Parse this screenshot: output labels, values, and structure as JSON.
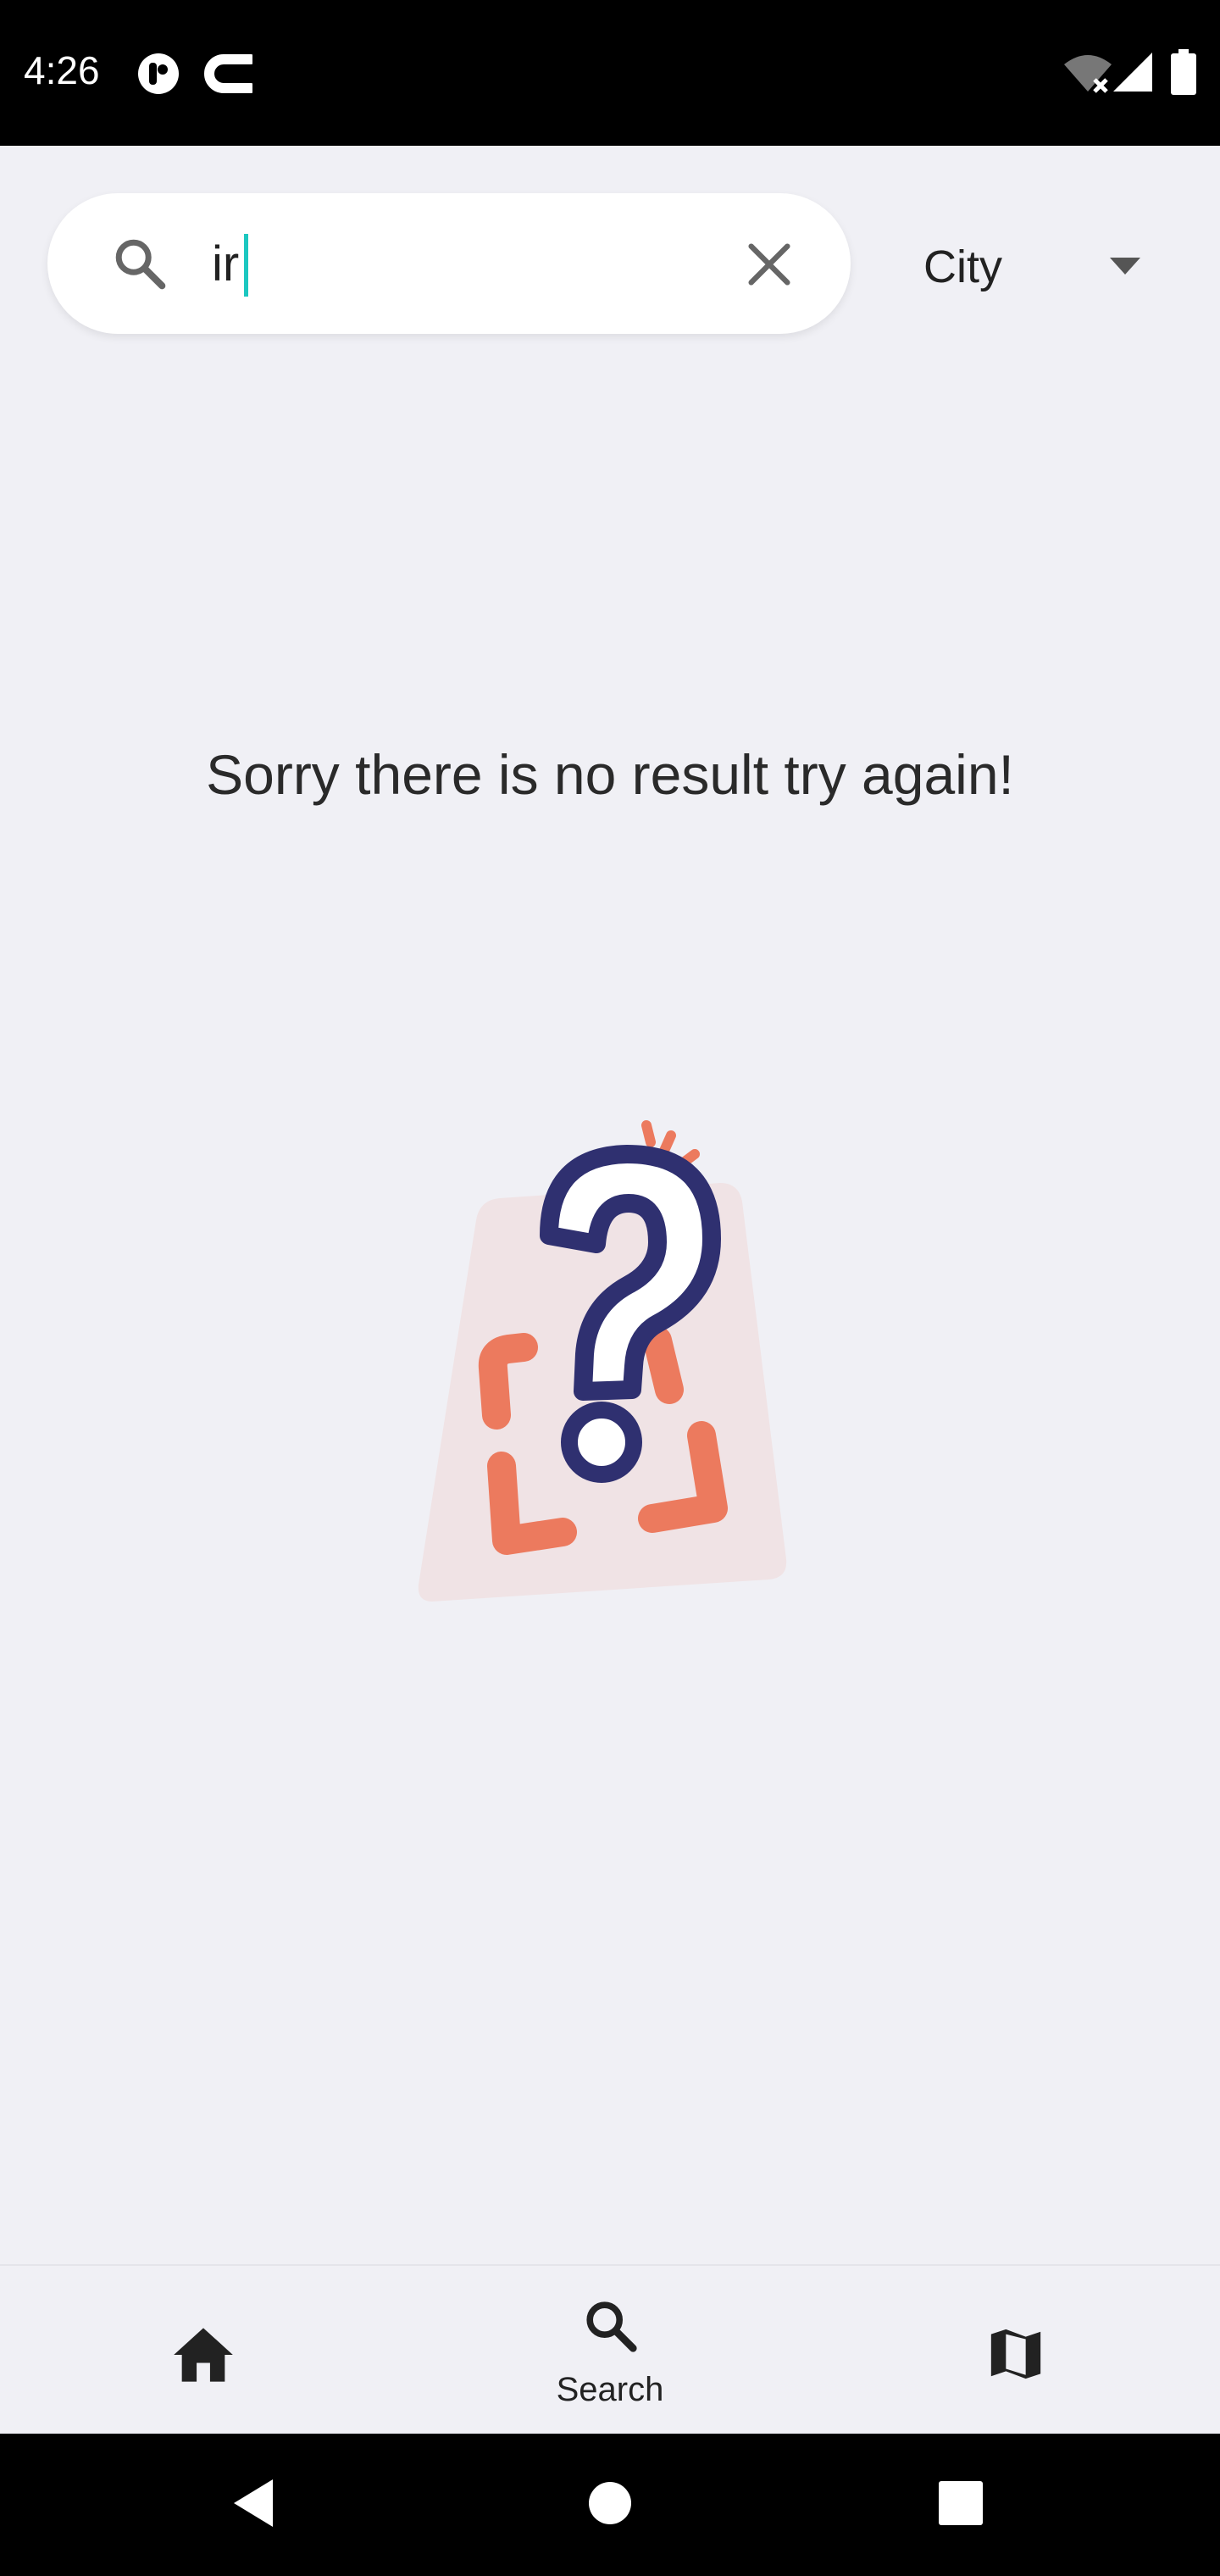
{
  "status_bar": {
    "time": "4:26",
    "icons": [
      "app-badge-icon",
      "c-app-icon",
      "wifi-off-icon",
      "signal-icon",
      "battery-icon"
    ]
  },
  "search": {
    "value": "ir",
    "placeholder": "",
    "city_label": "City"
  },
  "empty_state": {
    "message": "Sorry there is no result try again!",
    "illustration": "question-mark-illustration"
  },
  "bottom_nav": {
    "items": [
      {
        "icon": "home-icon",
        "label": ""
      },
      {
        "icon": "search-icon",
        "label": "Search"
      },
      {
        "icon": "map-icon",
        "label": ""
      }
    ],
    "active_index": 1
  },
  "system_nav": {
    "icons": [
      "back-icon",
      "home-circle-icon",
      "recents-icon"
    ]
  },
  "colors": {
    "accent": "#1cc7c0",
    "illustration_orange": "#ec7a5e",
    "illustration_navy": "#2f3070",
    "illustration_bg": "#f0e3e5",
    "background": "#f0f0f5"
  }
}
